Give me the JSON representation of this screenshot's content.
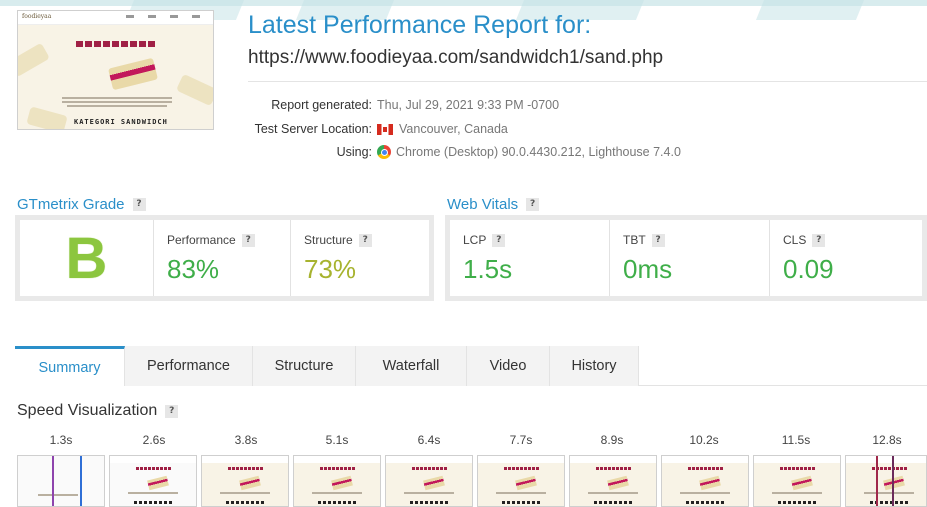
{
  "report": {
    "title": "Latest Performance Report for:",
    "url": "https://www.foodieyaa.com/sandwidch1/sand.php",
    "meta": [
      {
        "label": "Report generated:",
        "value": "Thu, Jul 29, 2021 9:33 PM -0700",
        "icon": ""
      },
      {
        "label": "Test Server Location:",
        "value": "Vancouver, Canada",
        "icon": "canada-flag-icon"
      },
      {
        "label": "Using:",
        "value": "Chrome (Desktop) 90.0.4430.212, Lighthouse 7.4.0",
        "icon": "chrome-icon"
      }
    ]
  },
  "thumbnail": {
    "logo": "foodieyaa",
    "footer": "KATEGORI SANDWIDCH"
  },
  "grade": {
    "heading": "GTmetrix Grade",
    "help": "?",
    "letter": "B",
    "letter_color": "#8cc63f",
    "metrics": [
      {
        "label": "Performance",
        "value": "83%",
        "color": "#3fae49"
      },
      {
        "label": "Structure",
        "value": "73%",
        "color": "#a7b32f"
      }
    ]
  },
  "vitals": {
    "heading": "Web Vitals",
    "help": "?",
    "metrics": [
      {
        "label": "LCP",
        "value": "1.5s",
        "color": "#3fae49"
      },
      {
        "label": "TBT",
        "value": "0ms",
        "color": "#3fae49"
      },
      {
        "label": "CLS",
        "value": "0.09",
        "color": "#3fae49"
      }
    ]
  },
  "tabs": [
    {
      "label": "Summary",
      "active": true
    },
    {
      "label": "Performance",
      "active": false
    },
    {
      "label": "Structure",
      "active": false
    },
    {
      "label": "Waterfall",
      "active": false
    },
    {
      "label": "Video",
      "active": false
    },
    {
      "label": "History",
      "active": false
    }
  ],
  "speed_visualization": {
    "heading": "Speed Visualization",
    "help": "?",
    "times": [
      "1.3s",
      "2.6s",
      "3.8s",
      "5.1s",
      "6.4s",
      "7.7s",
      "8.9s",
      "10.2s",
      "11.5s",
      "12.8s"
    ]
  },
  "colors": {
    "accent": "#2a8fc9",
    "good": "#3fae49",
    "average": "#a7b32f"
  }
}
